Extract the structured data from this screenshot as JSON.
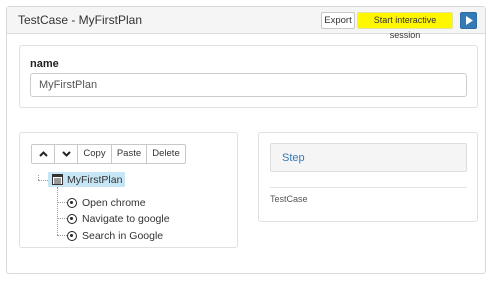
{
  "header": {
    "title": "TestCase - MyFirstPlan",
    "export_label": "Export",
    "interactive_label": "Start interactive session",
    "play_icon": "play-icon",
    "accent": "#337ab7",
    "highlight": "#fff700"
  },
  "name_section": {
    "label": "name",
    "value": "MyFirstPlan"
  },
  "toolbar": {
    "up_icon": "chevron-up-icon",
    "down_icon": "chevron-down-icon",
    "copy_label": "Copy",
    "paste_label": "Paste",
    "delete_label": "Delete"
  },
  "tree": {
    "root": {
      "label": "MyFirstPlan",
      "icon": "plan-icon",
      "selected": true
    },
    "items": [
      {
        "label": "Open chrome",
        "icon": "radio-icon"
      },
      {
        "label": "Navigate to google",
        "icon": "radio-icon"
      },
      {
        "label": "Search in Google",
        "icon": "radio-icon"
      }
    ]
  },
  "step_panel": {
    "title": "Step",
    "subtitle": "TestCase"
  }
}
